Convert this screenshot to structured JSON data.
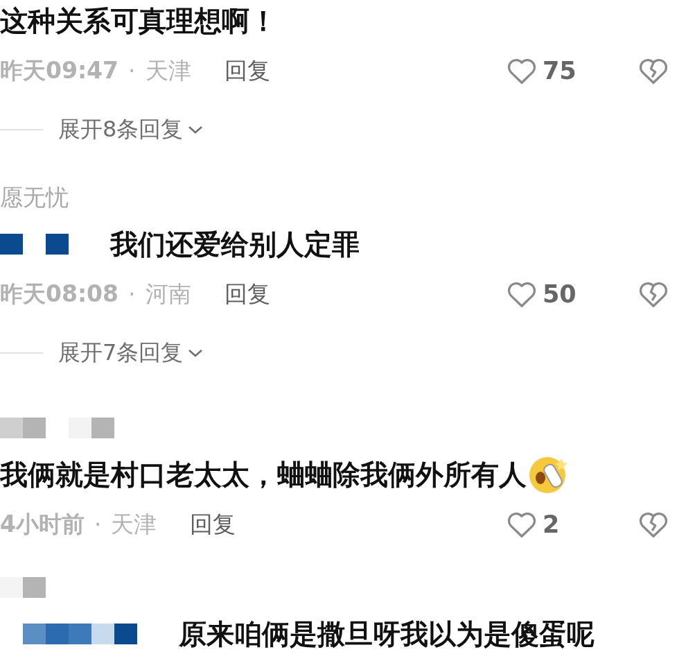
{
  "comments": [
    {
      "body": {
        "text": "这种关系可真理想啊！"
      },
      "meta": {
        "time": "昨天09:47",
        "separator": "·",
        "location": "天津",
        "reply": "回复",
        "likes": "75"
      },
      "expand": {
        "label": "展开8条回复"
      }
    },
    {
      "username": {
        "text": "愿无忧"
      },
      "body": {
        "mosaic": [
          {
            "color": "#0b4a8e"
          },
          {
            "color": "#ffffff"
          },
          {
            "color": "#0b4a8e"
          }
        ],
        "text": "我们还爱给别人定罪"
      },
      "meta": {
        "time": "昨天08:08",
        "separator": "·",
        "location": "河南",
        "reply": "回复",
        "likes": "50"
      },
      "expand": {
        "label": "展开7条回复"
      }
    },
    {
      "username": {
        "mosaic": [
          {
            "color": "#cfcfcf"
          },
          {
            "color": "#b4b4b4"
          },
          {
            "color": "#ffffff"
          },
          {
            "color": "#f3f3f3"
          },
          {
            "color": "#b4b4b4"
          }
        ]
      },
      "body": {
        "text": "我俩就是村口老太太，蛐蛐除我俩外所有人",
        "emoji": true
      },
      "meta": {
        "time": "4小时前",
        "separator": "·",
        "location": "天津",
        "reply": "回复",
        "likes": "2"
      }
    },
    {
      "username": {
        "mosaic": [
          {
            "color": "#f4f4f4"
          },
          {
            "color": "#b4b4b4"
          }
        ]
      },
      "body": {
        "mosaic": [
          {
            "color": "#ffffff"
          },
          {
            "color": "#5b8fc4"
          },
          {
            "color": "#2d6bb0"
          },
          {
            "color": "#3e7ab9"
          },
          {
            "color": "#c7daee"
          },
          {
            "color": "#0b4a8e"
          }
        ],
        "text": "原来咱俩是撒旦呀我以为是傻蛋呢"
      }
    }
  ]
}
